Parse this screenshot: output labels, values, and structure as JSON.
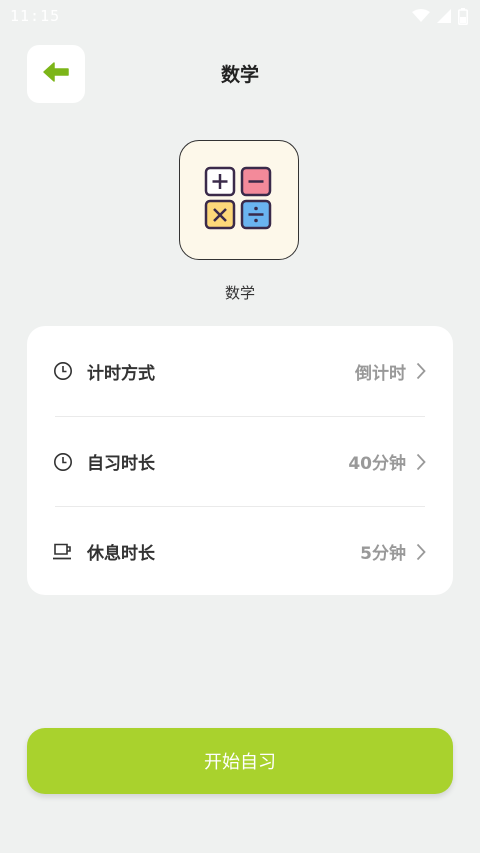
{
  "status_bar": {
    "time": "11:15",
    "icons": [
      "wifi-icon",
      "signal-icon",
      "battery-icon"
    ]
  },
  "header": {
    "back_icon": "arrow-left-icon",
    "title": "数学"
  },
  "subject": {
    "icon": "calculator-icon",
    "name": "数学"
  },
  "settings": {
    "items": [
      {
        "icon": "clock-icon",
        "label": "计时方式",
        "value": "倒计时"
      },
      {
        "icon": "clock-icon",
        "label": "自习时长",
        "value": "40分钟"
      },
      {
        "icon": "coffee-cup-icon",
        "label": "休息时长",
        "value": "5分钟"
      }
    ]
  },
  "start_button": {
    "label": "开始自习"
  },
  "colors": {
    "background": "#eff1f0",
    "accent": "#a9d22d",
    "back_arrow": "#7cb518",
    "value_text": "#999999"
  }
}
